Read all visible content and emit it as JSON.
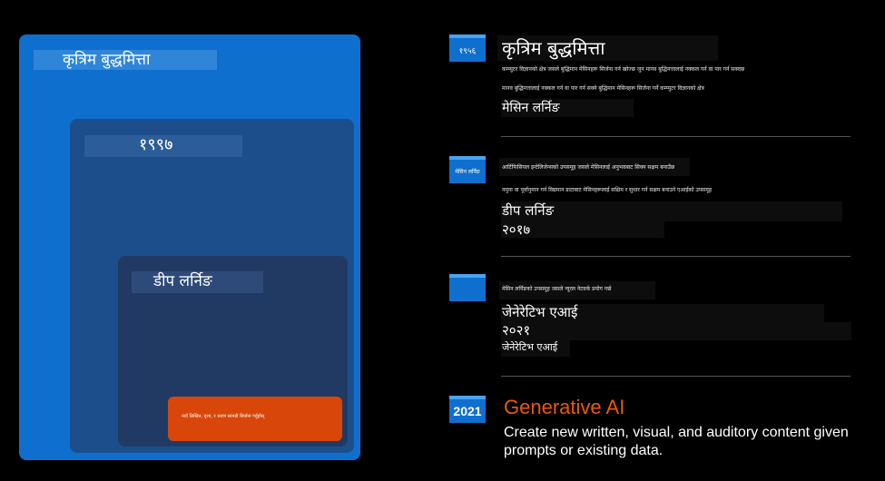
{
  "diagram": {
    "ai_label": "कृत्रिम बुद्धमित्ता",
    "ml_label": "१९९७",
    "dl_label": "डीप लर्निङ",
    "gen_text": "नयाँ लिखित, दृश्य, र श्रवण सामग्री सिर्जना गर्नुहोस्"
  },
  "timeline": {
    "item1": {
      "year": "१९५६",
      "title": "कृत्रिम बुद्धमित्ता",
      "desc1": "कम्प्युटर विज्ञानको क्षेत्र जसले बुद्धिमान मेसिनहरू सिर्जना गर्न खोज्छ जुन मानव बुद्धिमत्तालाई नक्कल गर्न वा पार गर्न सक्दछ",
      "desc2": "मानव बुद्धिमत्तालाई नक्कल गर्न वा पार गर्न सक्ने बुद्धिमान मेसिनहरू सिर्जना गर्ने कम्प्युटर विज्ञानको क्षेत्र",
      "sub": "मेसिन लर्निङ"
    },
    "item2": {
      "year": "मेसिन लर्निङ",
      "line1": "आर्टिफिसियल इन्टेलिजेन्सको उपसमूह जसले मेसिनलाई अनुभवबाट सिक्न सक्षम बनाउँछ",
      "line2": "नमुना वा पूर्वानुमान गर्न विद्यमान डाटाबाट मेसिनहरूलाई सक्षिम र सुधार गर्न सक्षम बनाउने एआईको उपसमूह",
      "title": "डीप लर्निङ",
      "year2": "२०१७"
    },
    "item3": {
      "line1": "मेसिन लर्निङको उपसमूह जसले न्यूरल नेटवर्क प्रयोग गर्छ",
      "title": "जेनेरेटिभ एआई",
      "year": "२०२१",
      "sub": "जेनेरेटिभ एआई"
    },
    "item4": {
      "year": "2021",
      "title": "Generative AI",
      "desc": "Create new written, visual, and auditory content given prompts or existing data."
    }
  },
  "colors": {
    "ai_box": "#0f6fce",
    "ml_box": "#1c4e8c",
    "dl_box": "#213a63",
    "gen_box": "#d94609",
    "gen_title": "#e8590c"
  }
}
